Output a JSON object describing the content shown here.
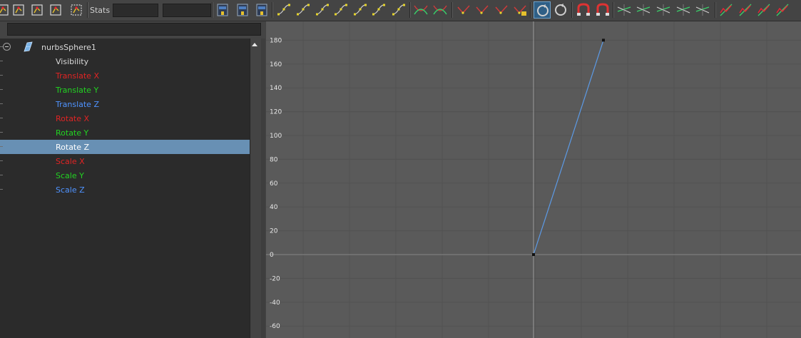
{
  "toolbar": {
    "stats_label": "Stats",
    "buttons": [
      {
        "name": "key-stats-icon"
      },
      {
        "name": "buffer-curve-icon"
      },
      {
        "name": "insert-key-icon"
      },
      {
        "name": "lattice-deform-icon"
      },
      {
        "name": "region-select-icon"
      },
      {
        "name": "frame-all-icon"
      },
      {
        "name": "frame-playback-icon"
      },
      {
        "name": "center-current-time-icon"
      },
      {
        "name": "auto-tangent-icon"
      },
      {
        "name": "spline-tangent-icon"
      },
      {
        "name": "clamped-tangent-icon"
      },
      {
        "name": "linear-tangent-icon"
      },
      {
        "name": "flat-tangent-icon"
      },
      {
        "name": "step-tangent-icon"
      },
      {
        "name": "plateau-tangent-icon"
      },
      {
        "name": "break-tangents-icon"
      },
      {
        "name": "unify-tangents-icon"
      },
      {
        "name": "free-tangent-weight-icon"
      },
      {
        "name": "lock-tangent-weight-icon"
      },
      {
        "name": "weighted-tangents-icon"
      },
      {
        "name": "lock-weight-icon"
      },
      {
        "name": "auto-load-icon"
      },
      {
        "name": "load-selected-icon"
      },
      {
        "name": "time-snap-icon"
      },
      {
        "name": "value-snap-icon"
      },
      {
        "name": "pre-infinity-cycle-icon"
      },
      {
        "name": "pre-infinity-offset-icon"
      },
      {
        "name": "post-infinity-cycle-icon"
      },
      {
        "name": "post-infinity-offset-icon"
      },
      {
        "name": "constant-infinity-icon"
      },
      {
        "name": "normalize-curves-icon"
      },
      {
        "name": "denormalize-curves-icon"
      },
      {
        "name": "absolute-view-icon"
      },
      {
        "name": "stacked-view-icon"
      }
    ]
  },
  "outliner": {
    "object": "nurbsSphere1",
    "channels": [
      {
        "label": "Visibility",
        "color": "#d8d8d8",
        "selected": false
      },
      {
        "label": "Translate X",
        "color": "#e02424",
        "selected": false
      },
      {
        "label": "Translate Y",
        "color": "#22d322",
        "selected": false
      },
      {
        "label": "Translate Z",
        "color": "#4f93ff",
        "selected": false
      },
      {
        "label": "Rotate X",
        "color": "#e02424",
        "selected": false
      },
      {
        "label": "Rotate Y",
        "color": "#22d322",
        "selected": false
      },
      {
        "label": "Rotate Z",
        "color": "#ffffff",
        "selected": true
      },
      {
        "label": "Scale X",
        "color": "#e02424",
        "selected": false
      },
      {
        "label": "Scale Y",
        "color": "#22d322",
        "selected": false
      },
      {
        "label": "Scale Z",
        "color": "#4f93ff",
        "selected": false
      }
    ]
  },
  "chart_data": {
    "type": "line",
    "y_tick_labels": [
      "180",
      "160",
      "140",
      "120",
      "100",
      "80",
      "60",
      "40",
      "20",
      "0",
      "-20",
      "-40",
      "-60"
    ],
    "ylim": [
      -60,
      180
    ],
    "grid": true,
    "series": [
      {
        "curve_color": "#5c9ae6",
        "points": [
          [
            0,
            0
          ],
          [
            14,
            180
          ]
        ]
      }
    ]
  },
  "colors": {
    "selection": "#6890b4",
    "graph_bg": "#5a5a5a",
    "grid": "#525252",
    "axis": "#858585"
  }
}
